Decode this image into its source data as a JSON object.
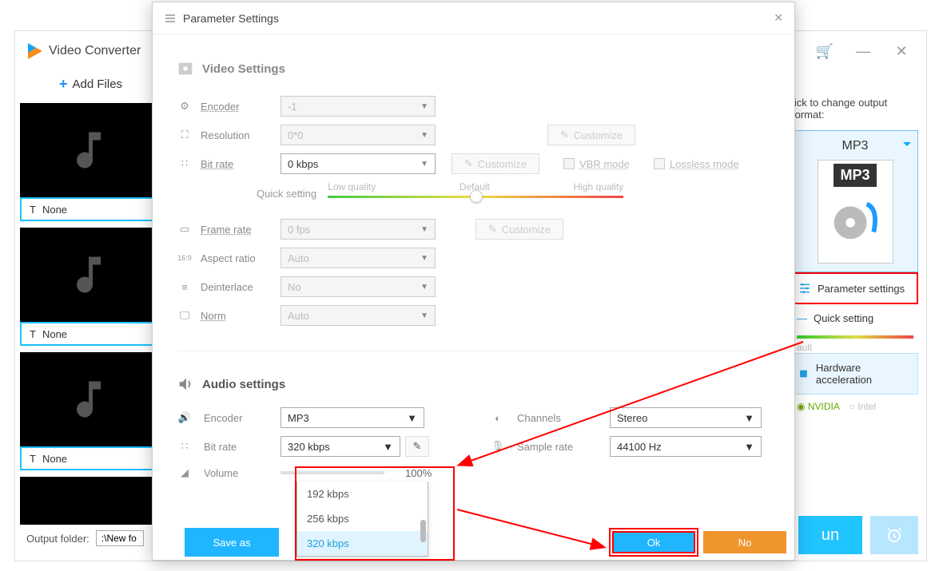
{
  "app": {
    "title": "Video Converter",
    "addFiles": "Add Files"
  },
  "titlebar": {
    "min": "—",
    "close": "✕"
  },
  "thumbs": [
    {
      "label": "None"
    },
    {
      "label": "None"
    },
    {
      "label": "None"
    }
  ],
  "right": {
    "hint": "lick to change output format:",
    "format": "MP3",
    "imgLabel": "MP3",
    "paramSettings": "Parameter settings",
    "quick": "Quick setting",
    "ault": "ault",
    "hw": "Hardware acceleration",
    "nvidia": "NVIDIA",
    "intel": "Intel"
  },
  "output": {
    "label": "Output folder:",
    "value": ":\\New fo",
    "run": "un"
  },
  "modal": {
    "title": "Parameter Settings",
    "sections": {
      "video": "Video Settings",
      "audio": "Audio settings"
    },
    "video": {
      "encoder": {
        "label": "Encoder",
        "value": "-1"
      },
      "resolution": {
        "label": "Resolution",
        "value": "0*0"
      },
      "bitrate": {
        "label": "Bit rate",
        "value": "0 kbps"
      },
      "custom": "Customize",
      "vbr": "VBR mode",
      "lossless": "Lossless mode",
      "quick": "Quick setting",
      "low": "Low quality",
      "def": "Default",
      "high": "High quality",
      "framerate": {
        "label": "Frame rate",
        "value": "0 fps"
      },
      "aspect": {
        "label": "Aspect ratio",
        "value": "Auto"
      },
      "deint": {
        "label": "Deinterlace",
        "value": "No"
      },
      "norm": {
        "label": "Norm",
        "value": "Auto"
      }
    },
    "audio": {
      "encoder": {
        "label": "Encoder",
        "value": "MP3"
      },
      "bitrate": {
        "label": "Bit rate",
        "value": "320 kbps"
      },
      "volume": {
        "label": "Volume",
        "pct": "100%"
      },
      "channels": {
        "label": "Channels",
        "value": "Stereo"
      },
      "sample": {
        "label": "Sample rate",
        "value": "44100 Hz"
      }
    },
    "dropdown": {
      "options": [
        "192 kbps",
        "256 kbps",
        "320 kbps"
      ]
    },
    "footer": {
      "saveas": "Save as",
      "ok": "Ok",
      "no": "No"
    }
  }
}
